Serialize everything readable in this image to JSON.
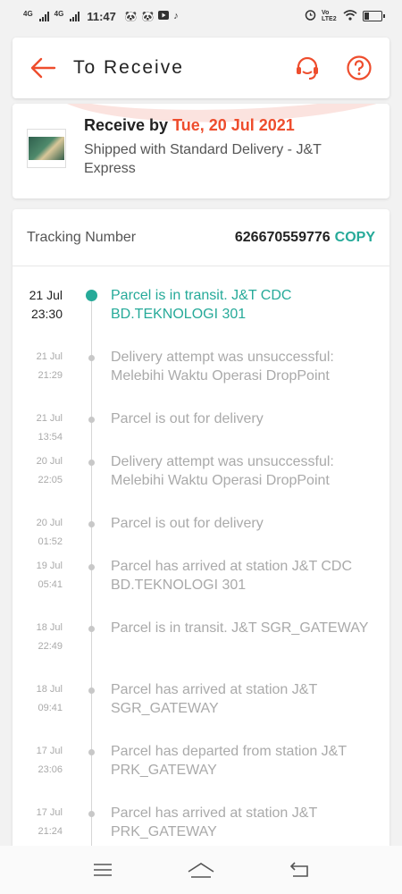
{
  "status_bar": {
    "net1": "4G",
    "net2": "4G",
    "time": "11:47",
    "icons": [
      "panda-icon",
      "panda-icon",
      "youtube-icon",
      "tiktok-icon"
    ],
    "volte": "Vo LTE2",
    "battery_label": "21"
  },
  "header": {
    "title": "To Receive",
    "accent_color": "#ee4d2d"
  },
  "delivery": {
    "receive_prefix": "Receive by",
    "receive_date": "Tue, 20 Jul 2021",
    "shipped_text": "Shipped with Standard Delivery  - J&T Express"
  },
  "tracking": {
    "label": "Tracking Number",
    "number": "626670559776",
    "copy_label": "COPY",
    "events": [
      {
        "date": "21 Jul",
        "time": "23:30",
        "desc": "Parcel is in transit. J&T CDC BD.TEKNOLOGI 301"
      },
      {
        "date": "21 Jul",
        "time": "21:29",
        "desc": "Delivery attempt was unsuccessful: Melebihi Waktu Operasi DropPoint"
      },
      {
        "date": "21 Jul",
        "time": "13:54",
        "desc": "Parcel is out for delivery"
      },
      {
        "date": "20 Jul",
        "time": "22:05",
        "desc": "Delivery attempt was unsuccessful: Melebihi Waktu Operasi DropPoint"
      },
      {
        "date": "20 Jul",
        "time": "01:52",
        "desc": "Parcel is out for delivery"
      },
      {
        "date": "19 Jul",
        "time": "05:41",
        "desc": "Parcel has arrived at station J&T CDC BD.TEKNOLOGI 301"
      },
      {
        "date": "18 Jul",
        "time": "22:49",
        "desc": "Parcel is in transit. J&T SGR_GATEWAY"
      },
      {
        "date": "18 Jul",
        "time": "09:41",
        "desc": "Parcel has arrived at station J&T SGR_GATEWAY"
      },
      {
        "date": "17 Jul",
        "time": "23:06",
        "desc": "Parcel has departed from station J&T PRK_GATEWAY"
      },
      {
        "date": "17 Jul",
        "time": "21:24",
        "desc": "Parcel has arrived at station J&T PRK_GATEWAY"
      }
    ]
  },
  "colors": {
    "teal": "#26aa99",
    "orange": "#ee4d2d"
  }
}
